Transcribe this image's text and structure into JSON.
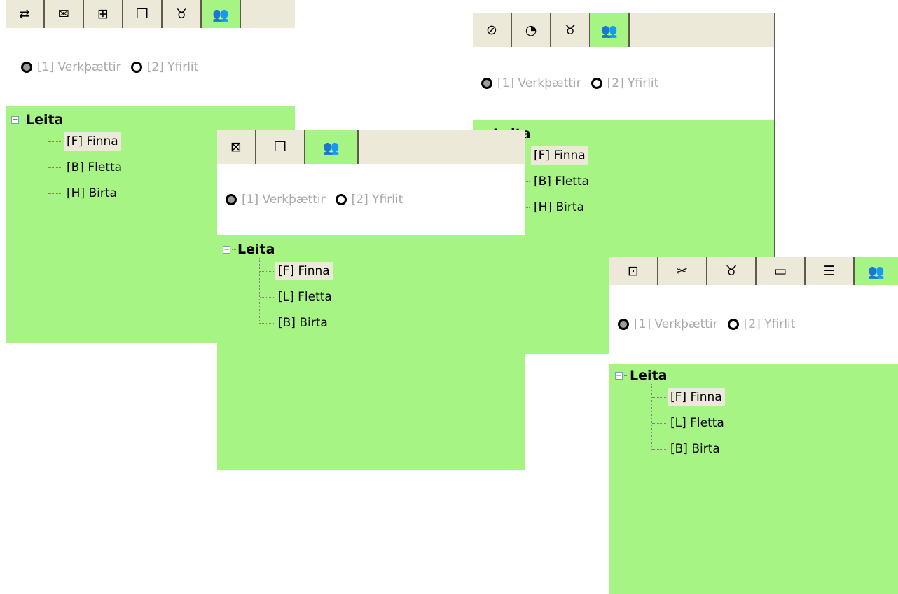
{
  "colors": {
    "panel_green": "#a6f584",
    "tabbar": "#ece9d8",
    "radio_text": "#a8a8a8"
  },
  "radio_options": [
    "[1] Verkþættir",
    "[2] Yfirlit"
  ],
  "tree_root": "Leita",
  "panels": [
    {
      "tabs": [
        "⇄",
        "✉",
        "⊞",
        "❐",
        "♉",
        "👥"
      ],
      "items": [
        "[F] Finna",
        "[B] Fletta",
        "[H] Birta"
      ]
    },
    {
      "tabs": [
        "⊠",
        "❐",
        "👥"
      ],
      "items": [
        "[F] Finna",
        "[L] Fletta",
        "[B] Birta"
      ]
    },
    {
      "tabs": [
        "⊘",
        "◔",
        "♉",
        "👥"
      ],
      "items": [
        "[F] Finna",
        "[B] Fletta",
        "[H] Birta"
      ]
    },
    {
      "tabs": [
        "⊡",
        "✂",
        "♉",
        "▭",
        "☰",
        "👥"
      ],
      "items": [
        "[F] Finna",
        "[L] Fletta",
        "[B] Birta"
      ]
    }
  ]
}
